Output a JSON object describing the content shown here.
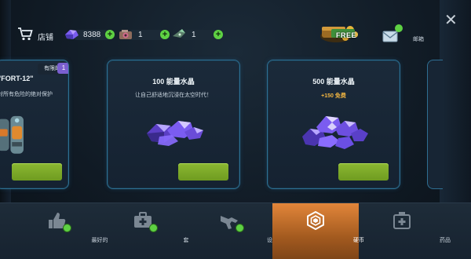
{
  "topbar": {
    "shop_label": "店铺",
    "currencies": [
      {
        "icon": "crystal-icon",
        "value": "8388"
      },
      {
        "icon": "gear-box-icon",
        "value": "1"
      },
      {
        "icon": "spaceship-icon",
        "value": "1"
      }
    ],
    "free_label": "FREE",
    "mail_label": "邮箱"
  },
  "cards": {
    "left": {
      "tag": "有限的",
      "tag_count": "1",
      "title": "\"FORT-12\"",
      "desc": "对所有危险的绝对保护"
    },
    "middle": {
      "title": "100 能量水晶",
      "desc": "让自己舒适地沉浸在太空时代！"
    },
    "right": {
      "title": "500 能量水晶",
      "bonus": "+150 免费"
    }
  },
  "nav": {
    "items": [
      {
        "label": "最好的",
        "icon": "thumbs-up-icon"
      },
      {
        "label": "套",
        "icon": "first-aid-kit-icon"
      },
      {
        "label": "设备",
        "icon": "gun-icon"
      },
      {
        "label": "硬币",
        "icon": "hexagon-coin-icon",
        "active": true
      },
      {
        "label": "药品",
        "icon": "medicine-icon"
      }
    ]
  },
  "colors": {
    "accent_green": "#5ed143",
    "active_tab": "#e2863a",
    "card_border": "#2f6f93",
    "buy_button": "#7aa826",
    "bonus_text": "#f4b742"
  }
}
